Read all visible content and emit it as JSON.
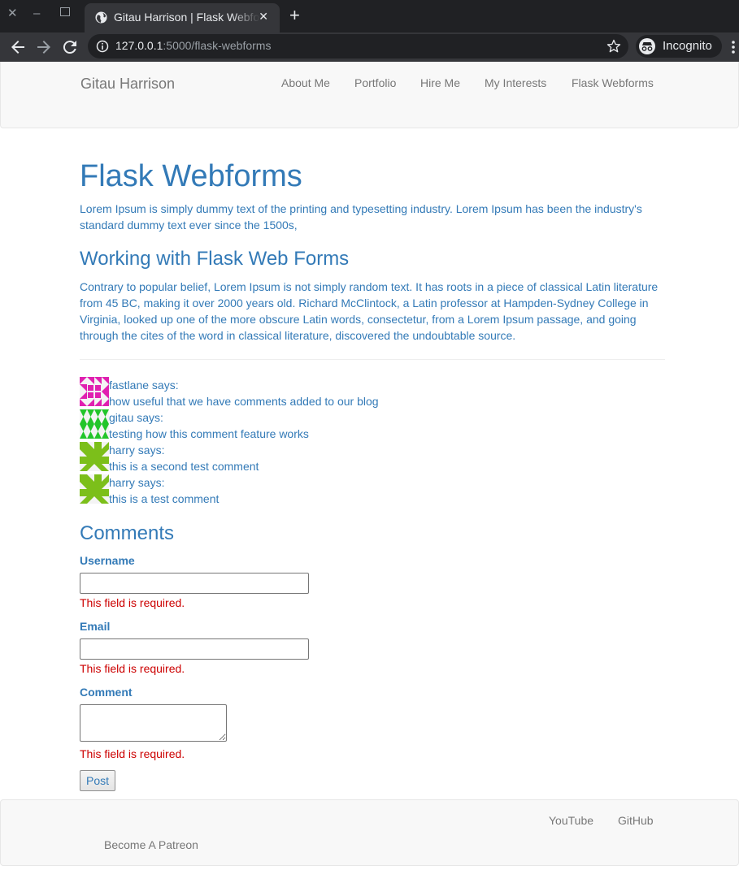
{
  "browser": {
    "tab_title": "Gitau Harrison | Flask Webforms",
    "url_host": "127.0.0.1",
    "url_rest": ":5000/flask-webforms",
    "incognito_label": "Incognito",
    "close_glyph": "✕",
    "minimize_glyph": "–",
    "new_tab_glyph": "+"
  },
  "navbar": {
    "brand": "Gitau Harrison",
    "links": [
      "About Me",
      "Portfolio",
      "Hire Me",
      "My Interests",
      "Flask Webforms"
    ]
  },
  "page": {
    "title": "Flask Webforms",
    "intro": "Lorem Ipsum is simply dummy text of the printing and typesetting industry. Lorem Ipsum has been the industry's standard dummy text ever since the 1500s,",
    "subtitle": "Working with Flask Web Forms",
    "body": "Contrary to popular belief, Lorem Ipsum is not simply random text. It has roots in a piece of classical Latin literature from 45 BC, making it over 2000 years old. Richard McClintock, a Latin professor at Hampden-Sydney College in Virginia, looked up one of the more obscure Latin words, consectetur, from a Lorem Ipsum passage, and going through the cites of the word in classical literature, discovered the undoubtable source."
  },
  "comments": [
    {
      "author": "fastlane says:",
      "body": "how useful that we have comments added to our blog",
      "avatar_color": "#e020b0"
    },
    {
      "author": "gitau says:",
      "body": "testing how this comment feature works",
      "avatar_color": "#22c52a"
    },
    {
      "author": "harry says:",
      "body": "this is a second test comment",
      "avatar_color": "#7cbf1a"
    },
    {
      "author": "harry says:",
      "body": "this is a test comment",
      "avatar_color": "#7cbf1a"
    }
  ],
  "form": {
    "heading": "Comments",
    "username_label": "Username",
    "username_value": "",
    "username_error": "This field is required.",
    "email_label": "Email",
    "email_value": "",
    "email_error": "This field is required.",
    "comment_label": "Comment",
    "comment_value": "",
    "comment_error": "This field is required.",
    "submit_label": "Post"
  },
  "footer": {
    "links": [
      "YouTube",
      "GitHub"
    ],
    "patreon": "Become A Patreon"
  },
  "colors": {
    "link_blue": "#337ab7",
    "error_red": "#cc0000",
    "nav_gray": "#777777"
  }
}
